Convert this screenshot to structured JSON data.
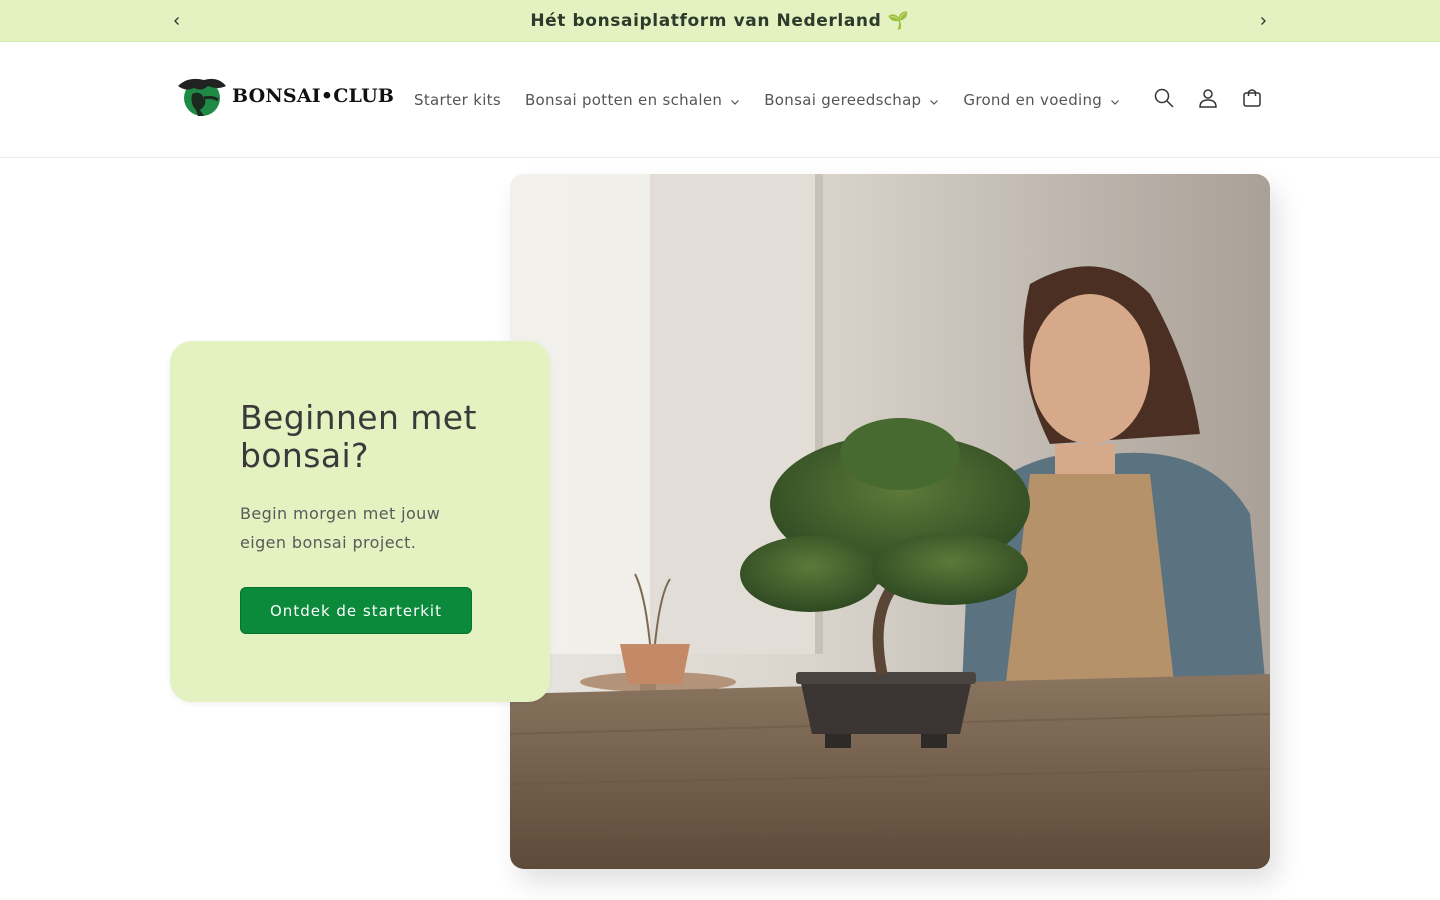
{
  "announcement": {
    "text": "Hét bonsaiplatform van Nederland 🌱",
    "prev_icon": "chevron-left-icon",
    "next_icon": "chevron-right-icon"
  },
  "header": {
    "logo_text": "BONSAI•CLUB",
    "nav": [
      {
        "label": "Starter kits",
        "has_dropdown": false
      },
      {
        "label": "Bonsai potten en schalen",
        "has_dropdown": true
      },
      {
        "label": "Bonsai gereedschap",
        "has_dropdown": true
      },
      {
        "label": "Grond en voeding",
        "has_dropdown": true
      }
    ],
    "icons": [
      "search-icon",
      "account-icon",
      "cart-icon"
    ]
  },
  "hero": {
    "title": "Beginnen met bonsai?",
    "subtitle": "Begin morgen met jouw eigen bonsai project.",
    "button_label": "Ontdek de starterkit",
    "image_alt": "Woman smiling at a bonsai tree on a wooden table"
  },
  "colors": {
    "accent_green": "#0a8a3a",
    "panel_green": "#e3f2c0"
  }
}
